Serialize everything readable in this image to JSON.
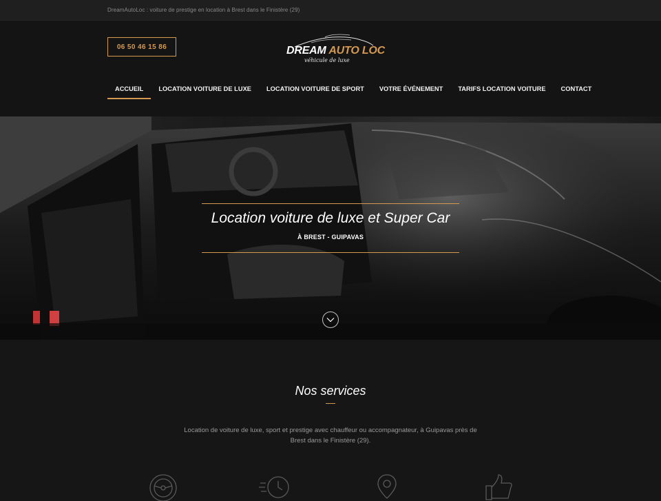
{
  "topbar": {
    "tagline": "DreamAutoLoc : voiture de prestige en location à Brest dans le Finistère (29)"
  },
  "header": {
    "phone": "06 50 46 15 86",
    "logo": {
      "word1": "DREAM",
      "word2": "AUTO LOC",
      "tagline": "véhicule de luxe"
    }
  },
  "nav": {
    "items": [
      {
        "label": "ACCUEIL",
        "active": true
      },
      {
        "label": "LOCATION VOITURE DE LUXE",
        "active": false
      },
      {
        "label": "LOCATION VOITURE DE SPORT",
        "active": false
      },
      {
        "label": "VOTRE ÉVÉNEMENT",
        "active": false
      },
      {
        "label": "TARIFS LOCATION VOITURE",
        "active": false
      },
      {
        "label": "CONTACT",
        "active": false
      }
    ]
  },
  "hero": {
    "title": "Location voiture de luxe et Super Car",
    "subtitle": "À BREST - GUIPAVAS",
    "scroll_icon": "chevron-down-icon"
  },
  "services": {
    "title": "Nos services",
    "description": "Location de voiture de luxe, sport et prestige avec chauffeur ou accompagnateur, à Guipavas près de Brest dans le Finistère (29).",
    "icons": [
      "steering-wheel-icon",
      "clock-icon",
      "location-pin-icon",
      "thumbs-up-icon"
    ]
  },
  "colors": {
    "accent": "#d49a52",
    "background": "#161616",
    "header_bg": "#141414",
    "topbar_bg": "#1f1f1f"
  }
}
